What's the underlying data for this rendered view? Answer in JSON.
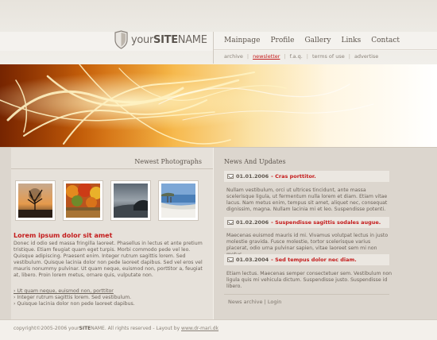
{
  "logo": {
    "prefix": "your",
    "strong": "SITE",
    "suffix": "NAME"
  },
  "mainnav": [
    "Mainpage",
    "Profile",
    "Gallery",
    "Links",
    "Contact"
  ],
  "subnav": [
    "archive",
    "newsletter",
    "f.a.q.",
    "terms of use",
    "advertise"
  ],
  "subnav_active": "newsletter",
  "photos": {
    "title": "Newest Photographs",
    "items": [
      "tree-sunset-photo",
      "autumn-forest-photo",
      "stormy-sea-photo",
      "lake-shore-photo"
    ]
  },
  "article": {
    "title": "Lorem ipsum dolor sit amet",
    "body": "Donec id odio sed massa fringilla laoreet. Phasellus in lectus et ante pretium tristique. Etiam feugiat quam eget turpis. Morbi commodo pede vel leo. Quisque adipiscing. Praesent enim. Integer rutrum sagittis lorem. Sed vestibulum. Quisque lacinia dolor non pede laoreet dapibus. Sed vel eros vel mauris nonummy pulvinar. Ut quam neque, euismod non, porttitor a, feugiat at, libero. Proin lorem metus, ornare quis, vulputate non.",
    "list": [
      "› Ut quam neque, euismod non, porttitor",
      "› Integer rutrum sagittis lorem. Sed vestibulum.",
      "› Quisque lacinia dolor non pede laoreet dapibus."
    ]
  },
  "news": {
    "title": "News And Updates",
    "items": [
      {
        "date": "01.01.2006",
        "headline": "Cras porttitor.",
        "text": "Nullam vestibulum, orci ut ultrices tincidunt, ante massa scelerisque ligula, ut fermentum nulla lorem et diam. Etiam vitae lacus. Nam metus enim, tempus sit amet, aliquet nec, consequat dignissim, magna. Nullam lacinia mi et leo. Suspendisse potenti."
      },
      {
        "date": "01.02.2006",
        "headline": "Suspendisse sagittis sodales augue.",
        "text": "Maecenas euismod mauris id mi. Vivamus volutpat lectus in justo molestie gravida. Fusce molestie, tortor scelerisque varius placerat, odio urna pulvinar sapien, vitae laoreet sem mi non metus."
      },
      {
        "date": "01.03.2004",
        "headline": "Sed tempus dolor nec diam.",
        "text": "Etiam lectus. Maecenas semper consectetuer sem. Vestibulum non ligula quis mi vehicula dictum. Suspendisse justo. Suspendisse id libero."
      }
    ],
    "footer_links": [
      "News archive",
      "Login"
    ],
    "footer_sep": "|"
  },
  "footer": {
    "copyright": "copyright©2005-2006 your",
    "strong": "SITE",
    "name": "NAME.",
    "rest": " All rights reserved - Layout by ",
    "link": "www.dr-mari.dk"
  },
  "colors": {
    "accent_red": "#c41b1b",
    "body_bg": "#dcd6ce",
    "text": "#6b6259"
  }
}
